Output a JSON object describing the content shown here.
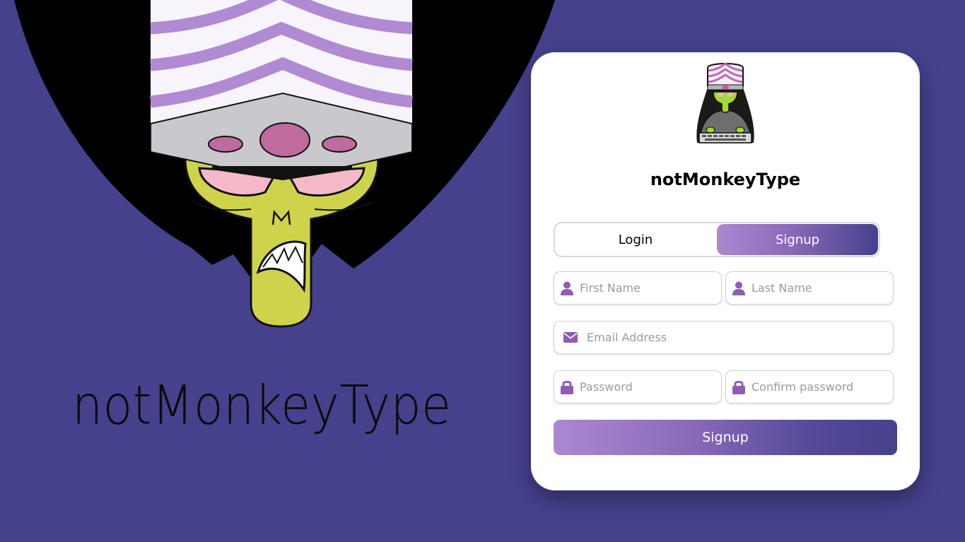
{
  "hero": {
    "title": "notMonkeyType",
    "image_icon": "mojo-jojo-illustration"
  },
  "card": {
    "logo_icon": "mojo-jojo-typing-logo",
    "title": "notMonkeyType",
    "tabs": [
      {
        "label": "Login",
        "active": false
      },
      {
        "label": "Signup",
        "active": true
      }
    ],
    "fields": {
      "first_name": {
        "placeholder": "First Name",
        "value": "",
        "icon": "user-icon"
      },
      "last_name": {
        "placeholder": "Last Name",
        "value": "",
        "icon": "user-icon"
      },
      "email": {
        "placeholder": "Email Address",
        "value": "",
        "icon": "envelope-icon"
      },
      "password": {
        "placeholder": "Password",
        "value": "",
        "icon": "lock-icon"
      },
      "confirm_password": {
        "placeholder": "Confirm password",
        "value": "",
        "icon": "lock-icon"
      }
    },
    "submit_label": "Signup"
  },
  "colors": {
    "background": "#45418c",
    "accent": "#8e5bb5",
    "gradient_start": "#ad88d2",
    "gradient_end": "#46418d"
  }
}
